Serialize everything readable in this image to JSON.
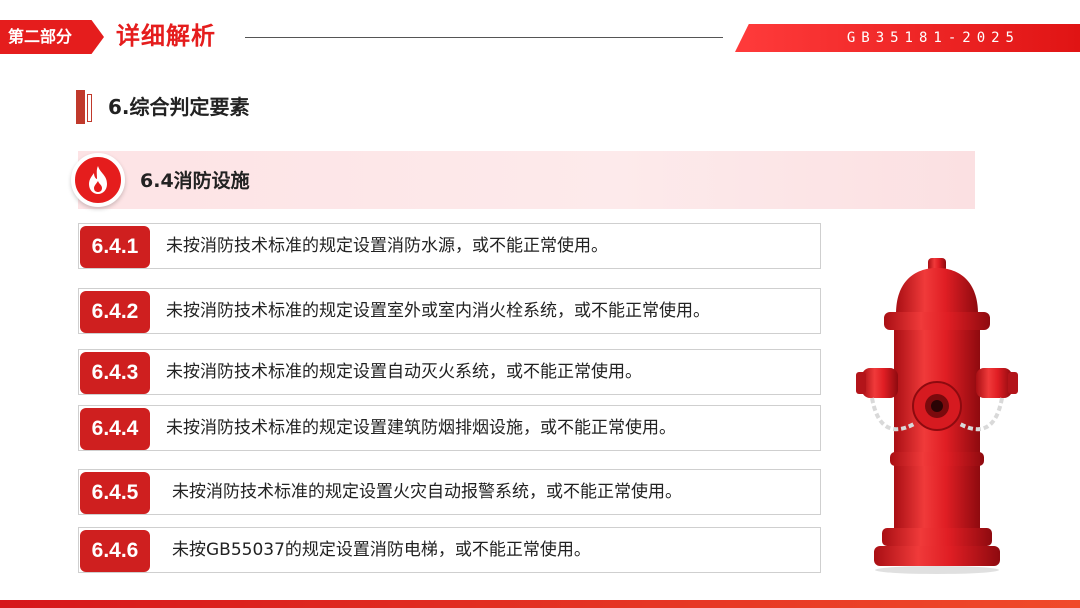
{
  "header": {
    "section_tag": "第二部分",
    "section_title": "详细解析",
    "standard_code": "GB35181-2025"
  },
  "heading": {
    "title": "6.综合判定要素"
  },
  "subsection": {
    "icon": "flame-icon",
    "title": "6.4消防设施"
  },
  "items": [
    {
      "code": "6.4.1",
      "text": "未按消防技术标准的规定设置消防水源，或不能正常使用。"
    },
    {
      "code": "6.4.2",
      "text": "未按消防技术标准的规定设置室外或室内消火栓系统，或不能正常使用。"
    },
    {
      "code": "6.4.3",
      "text": "未按消防技术标准的规定设置自动灭火系统，或不能正常使用。"
    },
    {
      "code": "6.4.4",
      "text": "未按消防技术标准的规定设置建筑防烟排烟设施，或不能正常使用。"
    },
    {
      "code": "6.4.5",
      "text": "未按消防技术标准的规定设置火灾自动报警系统，或不能正常使用。"
    },
    {
      "code": "6.4.6",
      "text": "未按GB55037的规定设置消防电梯，或不能正常使用。"
    }
  ],
  "illustration": {
    "icon": "fire-hydrant-icon"
  },
  "colors": {
    "accent": "#e51d1d",
    "band_pink": "#fde3e5",
    "badge_red": "#cf1f1f"
  }
}
